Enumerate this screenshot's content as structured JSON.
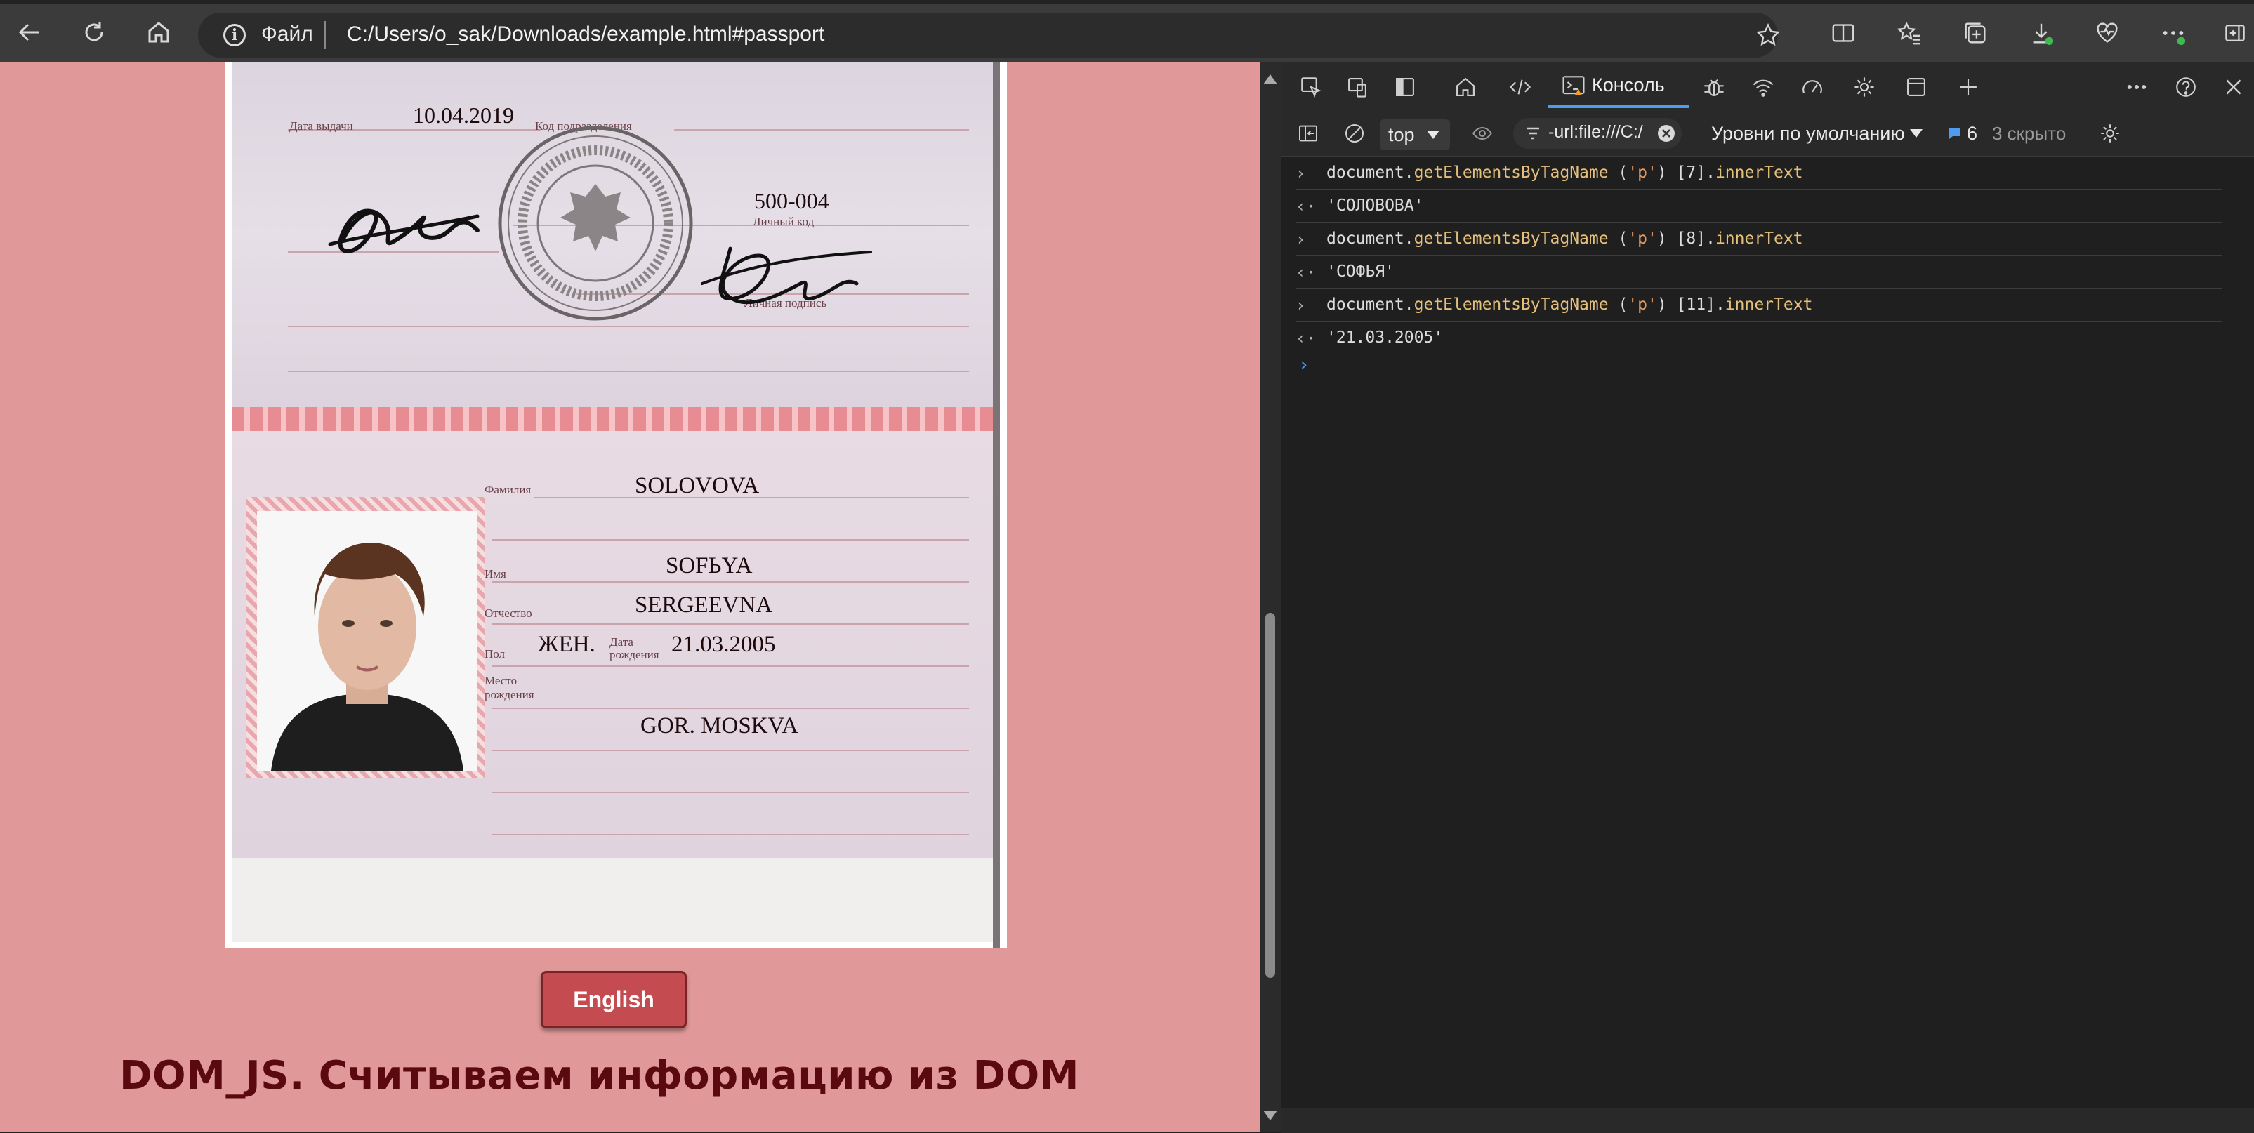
{
  "browser": {
    "address": {
      "file_label": "Файл",
      "url": "C:/Users/o_sak/Downloads/example.html#passport"
    },
    "icons": [
      "back-icon",
      "refresh-icon",
      "home-icon",
      "info-icon",
      "star-icon",
      "split-screen-icon",
      "favorites-icon",
      "collections-icon",
      "downloads-icon",
      "browser-essentials-icon",
      "more-icon",
      "sidebar-icon"
    ]
  },
  "page": {
    "passport": {
      "issue_date_label": "Дата выдачи",
      "issue_date": "10.04.2019",
      "division_code_label": "Код подразделения",
      "division_code": "500-004",
      "personal_code_label": "Личный код",
      "signature_label": "Личная подпись",
      "surname_label": "Фамилия",
      "surname": "SOLOVOVA",
      "name_label": "Имя",
      "name": "SOFЬYA",
      "patronymic_label": "Отчество",
      "patronymic": "SERGEEVNA",
      "sex_label": "Пол",
      "sex": "ЖЕН.",
      "birth_date_label": "Дата рождения",
      "birth_date": "21.03.2005",
      "birth_place_label": "Место рождения",
      "birth_place": "GOR. MOSKVA"
    },
    "english_button": "English",
    "heading": "DOM_JS. Считываем информацию из DOM"
  },
  "devtools": {
    "tabs": {
      "console_label": "Консоль"
    },
    "toolbar": {
      "context": "top",
      "filter_value": "-url:file:///C:/",
      "levels": "Уровни по умолчанию",
      "issues_count": "6",
      "hidden_count": "3 скрыто"
    },
    "console": {
      "entries": [
        {
          "obj": "document",
          "method": "getElementsByTagName",
          "arg": "'p'",
          "index": "[7]",
          "prop": "innerText",
          "result": "'СОЛОВОВА'"
        },
        {
          "obj": "document",
          "method": "getElementsByTagName",
          "arg": "'p'",
          "index": "[8]",
          "prop": "innerText",
          "result": "'СОФЬЯ'"
        },
        {
          "obj": "document",
          "method": "getElementsByTagName",
          "arg": "'p'",
          "index": "[11]",
          "prop": "innerText",
          "result": "'21.03.2005'"
        }
      ]
    }
  },
  "colors": {
    "page_bg": "#e09898",
    "button": "#c44b4f",
    "heading": "#5a0a0e",
    "devtools_bg": "#1f1f1f",
    "accent": "#4e9cf0"
  }
}
